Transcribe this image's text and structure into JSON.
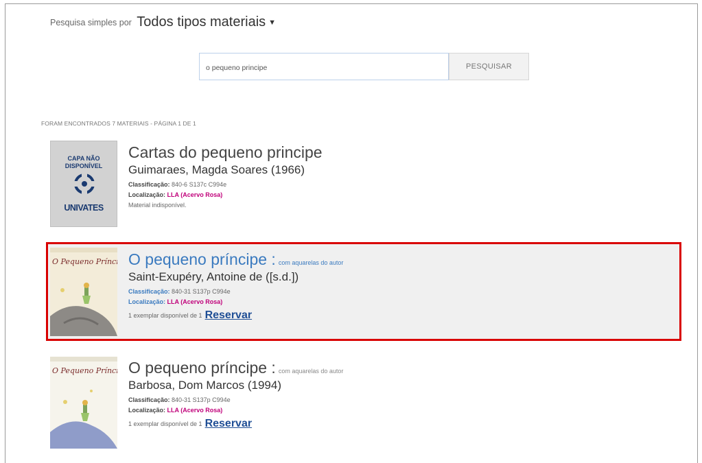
{
  "search": {
    "prefix": "Pesquisa simples por",
    "material_type": "Todos tipos materiais",
    "query": "o pequeno principe",
    "button_label": "PESQUISAR"
  },
  "results_summary": "FORAM ENCONTRADOS 7 MATERIAIS - PÁGINA 1 DE 1",
  "no_cover": {
    "line1": "CAPA NÃO",
    "line2": "DISPONÍVEL",
    "brand": "UNIVATES"
  },
  "labels": {
    "classification": "Classificação:",
    "location": "Localização:"
  },
  "results": [
    {
      "title": "Cartas do pequeno principe",
      "subtitle": "",
      "author": "Guimaraes, Magda Soares (1966)",
      "classification": "840-6 S137c C994e",
      "location": "LLA (Acervo Rosa)",
      "status": "Material indisponível.",
      "reserve": ""
    },
    {
      "title": "O pequeno príncipe :",
      "subtitle": "com aquarelas do autor",
      "author": "Saint-Exupéry, Antoine de ([s.d.])",
      "classification": "840-31 S137p C994e",
      "location": "LLA (Acervo Rosa)",
      "status": "1 exemplar disponível de 1",
      "reserve": "Reservar",
      "cover_title": "O Pequeno Príncipe"
    },
    {
      "title": "O pequeno príncipe :",
      "subtitle": "com aquarelas do autor",
      "author": "Barbosa, Dom Marcos (1994)",
      "classification": "840-31 S137p C994e",
      "location": "LLA (Acervo Rosa)",
      "status": "1 exemplar disponível de 1",
      "reserve": "Reservar",
      "cover_title": "O Pequeno Príncipe"
    }
  ],
  "colors": {
    "highlight_border": "#d90000",
    "link_blue": "#1f4e95",
    "location_magenta": "#c0007a"
  }
}
